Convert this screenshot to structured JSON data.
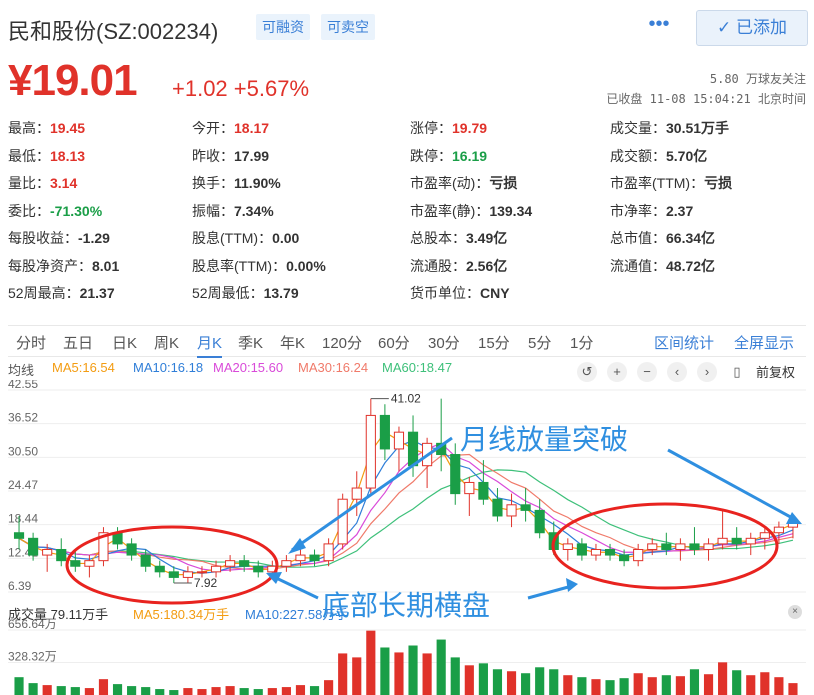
{
  "header": {
    "stock_name": "民和股份(SZ:002234)",
    "tag_margin": "可融资",
    "tag_short": "可卖空",
    "more": "•••",
    "added_button": "✓ 已添加"
  },
  "price": {
    "current": "¥19.01",
    "change": "+1.02 +5.67%",
    "followers": "5.80 万球友关注",
    "closed_info": "已收盘 11-08 15:04:21 北京时间"
  },
  "quote": {
    "col1": [
      {
        "label": "最高：",
        "value": "19.45",
        "cls": "up"
      },
      {
        "label": "最低：",
        "value": "18.13",
        "cls": "up"
      },
      {
        "label": "量比：",
        "value": "3.14",
        "cls": "up"
      },
      {
        "label": "委比：",
        "value": "-71.30%",
        "cls": "down"
      },
      {
        "label": "每股收益：",
        "value": "-1.29",
        "cls": ""
      },
      {
        "label": "每股净资产：",
        "value": "8.01",
        "cls": ""
      },
      {
        "label": "52周最高：",
        "value": "21.37",
        "cls": ""
      }
    ],
    "col2": [
      {
        "label": "今开：",
        "value": "18.17",
        "cls": "up"
      },
      {
        "label": "昨收：",
        "value": "17.99",
        "cls": ""
      },
      {
        "label": "换手：",
        "value": "11.90%",
        "cls": ""
      },
      {
        "label": "振幅：",
        "value": "7.34%",
        "cls": ""
      },
      {
        "label": "股息(TTM)：",
        "value": "0.00",
        "cls": ""
      },
      {
        "label": "股息率(TTM)：",
        "value": "0.00%",
        "cls": ""
      },
      {
        "label": "52周最低：",
        "value": "13.79",
        "cls": ""
      }
    ],
    "col3": [
      {
        "label": "涨停：",
        "value": "19.79",
        "cls": "up"
      },
      {
        "label": "跌停：",
        "value": "16.19",
        "cls": "down"
      },
      {
        "label": "市盈率(动)：",
        "value": "亏损",
        "cls": ""
      },
      {
        "label": "市盈率(静)：",
        "value": "139.34",
        "cls": ""
      },
      {
        "label": "总股本：",
        "value": "3.49亿",
        "cls": ""
      },
      {
        "label": "流通股：",
        "value": "2.56亿",
        "cls": ""
      },
      {
        "label": "货币单位：",
        "value": "CNY",
        "cls": ""
      }
    ],
    "col4": [
      {
        "label": "成交量：",
        "value": "30.51万手",
        "cls": ""
      },
      {
        "label": "成交额：",
        "value": "5.70亿",
        "cls": ""
      },
      {
        "label": "市盈率(TTM)：",
        "value": "亏损",
        "cls": ""
      },
      {
        "label": "市净率：",
        "value": "2.37",
        "cls": ""
      },
      {
        "label": "总市值：",
        "value": "66.34亿",
        "cls": ""
      },
      {
        "label": "流通值：",
        "value": "48.72亿",
        "cls": ""
      }
    ]
  },
  "periods": {
    "tabs": [
      "分时",
      "五日",
      "日K",
      "周K",
      "月K",
      "季K",
      "年K",
      "120分",
      "60分",
      "30分",
      "15分",
      "5分",
      "1分"
    ],
    "active": "月K",
    "interval_stats": "区间统计",
    "fullscreen": "全屏显示"
  },
  "ma": {
    "avg_label": "均线",
    "ma5": "MA5:16.54",
    "ma10": "MA10:16.18",
    "ma20": "MA20:15.60",
    "ma30": "MA30:16.24",
    "ma60": "MA60:18.47",
    "fq_label": "前复权"
  },
  "colors": {
    "up": "#e0322a",
    "down": "#1a9e47",
    "ma5": "#f39c12",
    "ma10": "#2f7ed8",
    "ma20": "#d94ad9",
    "ma30": "#f07a6a",
    "ma60": "#3ec07a",
    "annotation": "#2f8fe0"
  },
  "chart_data": {
    "type": "candlestick",
    "y_ticks": [
      "42.55",
      "36.52",
      "30.50",
      "24.47",
      "18.44",
      "12.41",
      "6.39"
    ],
    "high_label": "41.02",
    "low_label": "7.92",
    "volume_ticks": [
      "656.64万",
      "328.32万"
    ],
    "volume_label": "成交量 79.11万手",
    "vol_ma5": "MA5:180.34万手",
    "vol_ma10": "MA10:227.58万手",
    "annotation_top": "月线放量突破",
    "annotation_bottom": "底部长期横盘",
    "candles": [
      [
        17,
        20,
        14,
        16
      ],
      [
        16,
        17,
        12,
        13
      ],
      [
        13,
        15,
        10,
        14
      ],
      [
        14,
        16,
        11,
        12
      ],
      [
        12,
        14,
        10,
        11
      ],
      [
        11,
        13,
        9,
        12
      ],
      [
        12,
        18,
        11,
        17
      ],
      [
        17,
        18,
        14,
        15
      ],
      [
        15,
        16,
        12,
        13
      ],
      [
        13,
        14,
        10,
        11
      ],
      [
        11,
        12,
        9,
        10
      ],
      [
        10,
        11,
        8,
        9
      ],
      [
        9,
        11,
        8,
        10
      ],
      [
        10,
        11,
        9,
        10
      ],
      [
        10,
        12,
        9,
        11
      ],
      [
        11,
        13,
        10,
        12
      ],
      [
        12,
        13,
        10,
        11
      ],
      [
        11,
        12,
        9,
        10
      ],
      [
        10,
        12,
        9,
        11
      ],
      [
        11,
        13,
        10,
        12
      ],
      [
        12,
        14,
        11,
        13
      ],
      [
        13,
        14,
        11,
        12
      ],
      [
        12,
        16,
        11,
        15
      ],
      [
        15,
        24,
        14,
        23
      ],
      [
        23,
        28,
        20,
        25
      ],
      [
        25,
        41,
        24,
        38
      ],
      [
        38,
        40,
        30,
        32
      ],
      [
        32,
        36,
        28,
        35
      ],
      [
        35,
        38,
        27,
        29
      ],
      [
        29,
        34,
        25,
        33
      ],
      [
        33,
        41,
        28,
        31
      ],
      [
        31,
        33,
        22,
        24
      ],
      [
        24,
        27,
        20,
        26
      ],
      [
        26,
        30,
        22,
        23
      ],
      [
        23,
        25,
        19,
        20
      ],
      [
        20,
        24,
        18,
        22
      ],
      [
        22,
        25,
        19,
        21
      ],
      [
        21,
        23,
        16,
        17
      ],
      [
        17,
        19,
        13,
        14
      ],
      [
        14,
        16,
        12,
        15
      ],
      [
        15,
        16,
        12,
        13
      ],
      [
        13,
        15,
        12,
        14
      ],
      [
        14,
        15,
        12,
        13
      ],
      [
        13,
        14,
        11,
        12
      ],
      [
        12,
        15,
        11,
        14
      ],
      [
        14,
        16,
        13,
        15
      ],
      [
        15,
        17,
        13,
        14
      ],
      [
        14,
        16,
        12,
        15
      ],
      [
        15,
        18,
        13,
        14
      ],
      [
        14,
        16,
        12,
        15
      ],
      [
        15,
        21,
        14,
        16
      ],
      [
        16,
        18,
        14,
        15
      ],
      [
        15,
        17,
        13,
        16
      ],
      [
        16,
        18,
        14,
        17
      ],
      [
        17,
        19,
        15,
        18
      ],
      [
        18,
        20,
        16,
        19
      ]
    ],
    "volumes": [
      180,
      120,
      100,
      90,
      80,
      70,
      160,
      110,
      90,
      80,
      60,
      50,
      70,
      60,
      80,
      90,
      70,
      60,
      70,
      80,
      100,
      90,
      150,
      420,
      380,
      650,
      480,
      430,
      500,
      420,
      560,
      380,
      300,
      320,
      260,
      240,
      220,
      280,
      260,
      200,
      180,
      160,
      150,
      170,
      220,
      180,
      200,
      190,
      260,
      210,
      330,
      250,
      200,
      230,
      180,
      120
    ]
  }
}
